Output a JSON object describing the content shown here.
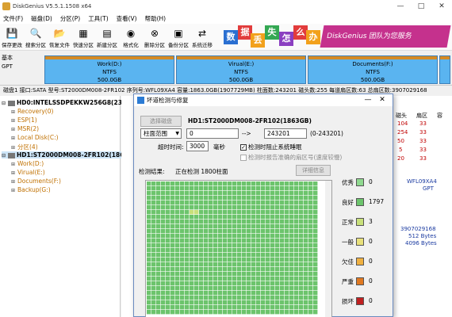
{
  "window": {
    "title": "DiskGenius V5.5.1.1508 x64",
    "controls": [
      "—",
      "□",
      "✕"
    ]
  },
  "menu": [
    "文件(F)",
    "磁盘(D)",
    "分区(P)",
    "工具(T)",
    "查看(V)",
    "帮助(H)"
  ],
  "toolbar": [
    {
      "label": "保存更改",
      "icon": "save-icon",
      "glyph": "💾"
    },
    {
      "label": "搜索分区",
      "icon": "search-partition-icon",
      "glyph": "🔍"
    },
    {
      "label": "恢复文件",
      "icon": "recover-file-icon",
      "glyph": "📂"
    },
    {
      "label": "快速分区",
      "icon": "quick-partition-icon",
      "glyph": "▦"
    },
    {
      "label": "新建分区",
      "icon": "new-partition-icon",
      "glyph": "▤"
    },
    {
      "label": "格式化",
      "icon": "format-icon",
      "glyph": "◉"
    },
    {
      "label": "删除分区",
      "icon": "delete-partition-icon",
      "glyph": "⊗"
    },
    {
      "label": "备份分区",
      "icon": "backup-partition-icon",
      "glyph": "▣"
    },
    {
      "label": "系统迁移",
      "icon": "system-migration-icon",
      "glyph": "⇄"
    }
  ],
  "banner": {
    "chars": [
      "数",
      "据",
      "丢",
      "失",
      "怎",
      "么",
      "办"
    ],
    "colors": [
      "#2a6fd1",
      "#e23c3c",
      "#f2a11c",
      "#34a853",
      "#8b3fc1",
      "#e23c3c",
      "#f2a11c"
    ],
    "slogan": "DiskGenius 团队为您服务"
  },
  "diskbar": {
    "info_line1": "基本",
    "info_line2": "GPT",
    "partitions": [
      {
        "name": "Work(D:)",
        "fs": "NTFS",
        "size": "500.0GB"
      },
      {
        "name": "Virual(E:)",
        "fs": "NTFS",
        "size": "500.0GB"
      },
      {
        "name": "Documents(F:)",
        "fs": "NTFS",
        "size": "500.0GB"
      }
    ]
  },
  "status_line": "磁盘1 接口:SATA  型号:ST2000DM008-2FR102  序列号:WFL09XA4  容量:1863.0GB(1907729MB)  柱面数:243201  磁头数:255  每道扇区数:63  总扇区数:3907029168",
  "tree": {
    "hd0": "HD0:INTELSSDPEKKW256G8(238GB)",
    "hd0_parts": [
      "Recovery(0)",
      "ESP(1)",
      "MSR(2)",
      "Local Disk(C:)",
      "分区(4)"
    ],
    "hd1": "HD1:ST2000DM008-2FR102(1863GB)",
    "hd1_parts": [
      "Work(D:)",
      "Virual(E:)",
      "Documents(F:)",
      "Backup(G:)"
    ]
  },
  "right_pane": {
    "cols": [
      "磁头",
      "扇区",
      "容"
    ],
    "rows": [
      [
        "104",
        "33"
      ],
      [
        "254",
        "33"
      ],
      [
        "50",
        "33"
      ],
      [
        "5",
        "33"
      ],
      [
        "20",
        "33"
      ]
    ],
    "serial": "WFL09XA4",
    "style": "GPT",
    "sectors_total": "3907029168",
    "sector_size": "512 Bytes",
    "physical_sector_size": "4096 Bytes"
  },
  "dialog": {
    "title": "坏道检测与修复",
    "select_disk_btn": "选择磁盘",
    "disk_name": "HD1:ST2000DM008-2FR102(1863GB)",
    "range_select": "柱面范围",
    "range_from": "0",
    "range_arrow": "-->",
    "range_to": "243201",
    "range_hint": "(0-243201)",
    "timeout_label": "超时时间:",
    "timeout_value": "3000",
    "timeout_unit": "毫秒",
    "stop_on_error_label": "检测时阻止系统睡眠",
    "stop_on_error_checked": "✓",
    "precise_label": "检测时报告准确的扇区号(速度较慢)",
    "result_label": "检测结果:",
    "progress_text": "正在检测  1800柱面",
    "detail_btn": "详细信息",
    "legend": [
      {
        "label": "优秀",
        "count": "0",
        "color": "#8fd98f"
      },
      {
        "label": "良好",
        "count": "1797",
        "color": "#6cc46c"
      },
      {
        "label": "正常",
        "count": "3",
        "color": "#c8e07a"
      },
      {
        "label": "一般",
        "count": "0",
        "color": "#e8e07a"
      },
      {
        "label": "欠佳",
        "count": "0",
        "color": "#f0b040"
      },
      {
        "label": "严重",
        "count": "0",
        "color": "#e07820"
      },
      {
        "label": "损坏",
        "count": "0",
        "color": "#c02020"
      }
    ],
    "grid": {
      "cell_good": "#6cc46c",
      "cell_normal": "#c8e07a",
      "progress_cells": 1800
    }
  }
}
